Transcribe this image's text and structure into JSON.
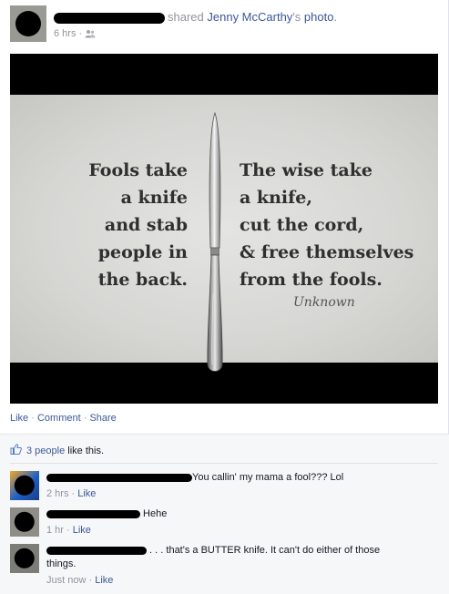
{
  "post": {
    "header": {
      "verb": "shared",
      "page_name": "Jenny McCarthy",
      "possessive": "'s",
      "object": "photo",
      "period": ".",
      "time": "6 hrs",
      "separator": " · ",
      "audience_icon": "friends-icon"
    },
    "photo": {
      "left_quote": [
        "Fools take",
        "a knife",
        "and stab",
        "people in",
        "the back."
      ],
      "right_quote": [
        "The wise take",
        "a knife,",
        "cut the cord,",
        "& free themselves",
        "from the fools."
      ],
      "signature": "Unknown"
    },
    "actions": {
      "like": "Like",
      "comment": "Comment",
      "share": "Share",
      "separator": " · "
    }
  },
  "feedback": {
    "likes": {
      "icon": "thumbs-up-icon",
      "count_text": "3 people",
      "suffix": " like this."
    },
    "comments": [
      {
        "text": "You callin' my mama a fool??? Lol",
        "time": "2 hrs",
        "like": "Like"
      },
      {
        "text": " Hehe",
        "time": "1 hr",
        "like": "Like"
      },
      {
        "text": " . . . that's a BUTTER knife. It can't do either of those things.",
        "time": "Just now",
        "like": "Like"
      }
    ]
  },
  "colors": {
    "link": "#3b5998",
    "muted": "#90949c",
    "feedback_bg": "#f6f7f9"
  }
}
